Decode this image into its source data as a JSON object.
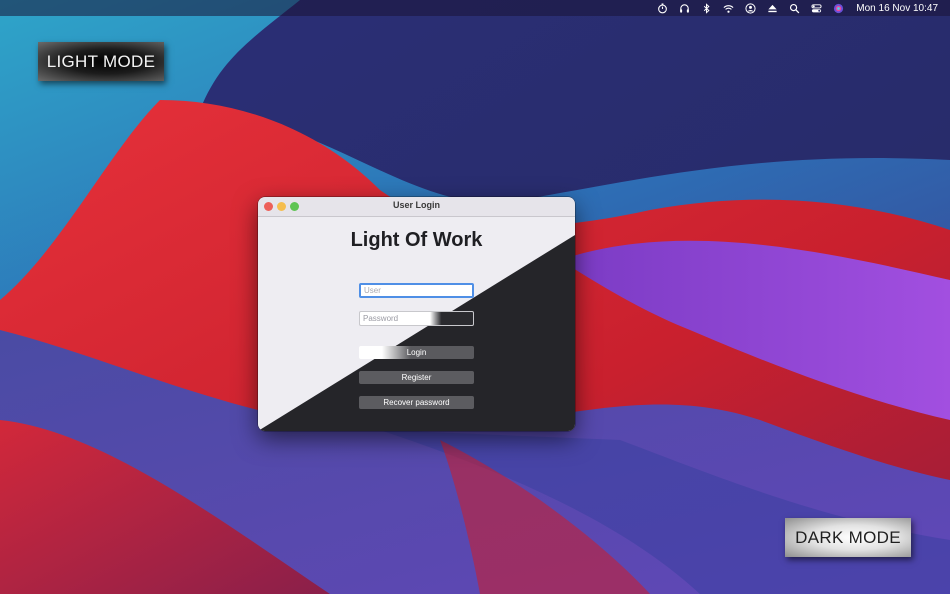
{
  "menubar": {
    "icons": [
      "timer-icon",
      "headphones-icon",
      "bluetooth-icon",
      "wifi-icon",
      "user-icon",
      "eject-icon",
      "search-icon",
      "control-center-icon",
      "siri-icon"
    ],
    "clock": "Mon 16 Nov  10:47"
  },
  "labels": {
    "light_mode": "LIGHT MODE",
    "dark_mode": "DARK MODE"
  },
  "window": {
    "title": "User Login",
    "app_title": "Light Of Work",
    "user_placeholder": "User",
    "password_placeholder": "Password",
    "login_label": "Login",
    "register_label": "Register",
    "recover_label": "Recover password"
  },
  "colors": {
    "close": "#ed5f58",
    "minimize": "#f5be4f",
    "maximize": "#5fc454",
    "focus_ring": "#4f8fe6",
    "dark_panel": "#252529",
    "light_panel": "#eeedf2"
  }
}
